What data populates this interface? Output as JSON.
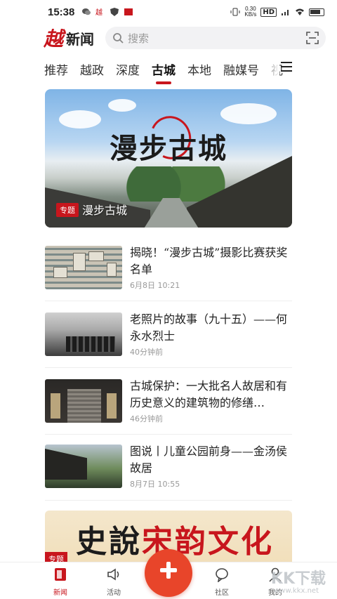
{
  "status_bar": {
    "time": "15:38",
    "speed_value": "0.30",
    "speed_unit": "KB/s",
    "hd_label": "HD"
  },
  "header": {
    "logo_char": "越",
    "logo_word": "新闻",
    "search_placeholder": "搜索"
  },
  "tabs": [
    {
      "label": "推荐",
      "active": false
    },
    {
      "label": "越政",
      "active": false
    },
    {
      "label": "深度",
      "active": false
    },
    {
      "label": "古城",
      "active": true
    },
    {
      "label": "本地",
      "active": false
    },
    {
      "label": "融媒号",
      "active": false
    },
    {
      "label": "视",
      "active": false
    }
  ],
  "banner": {
    "title": "漫步古城",
    "tag": "专题",
    "caption": "漫步古城"
  },
  "news": [
    {
      "title": "揭晓！“漫步古城”摄影比赛获奖名单",
      "meta": "6月8日  10:21"
    },
    {
      "title": "老照片的故事（九十五）——何永水烈士",
      "meta": "40分钟前"
    },
    {
      "title": "古城保护：一大批名人故居和有历史意义的建筑物的修缮…",
      "meta": "46分钟前"
    },
    {
      "title": "图说丨儿童公园前身——金汤侯故居",
      "meta": "8月7日  10:55"
    }
  ],
  "banner2": {
    "text_dark": "史說",
    "text_red": "宋韵文化",
    "tag": "专题"
  },
  "bottom_nav": [
    {
      "label": "新闻",
      "icon": "news-book-icon",
      "active": true
    },
    {
      "label": "活动",
      "icon": "speaker-icon",
      "active": false
    },
    {
      "label": "社区",
      "icon": "chat-bubble-icon",
      "active": false
    },
    {
      "label": "我的",
      "icon": "person-icon",
      "active": false
    }
  ],
  "watermark": {
    "text": "KK下载",
    "url": "www.kkx.net"
  },
  "colors": {
    "accent": "#c8161d",
    "plus_button": "#e8452a"
  }
}
